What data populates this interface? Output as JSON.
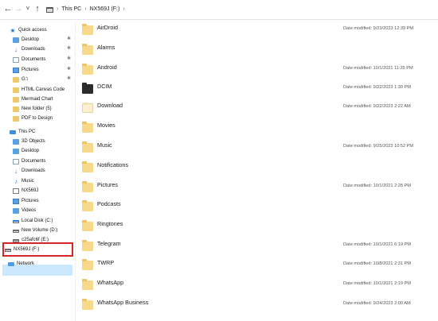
{
  "address_bar": {
    "back_glyph": "←",
    "forward_glyph": "→",
    "recent_glyph": "˅",
    "up_glyph": "↑",
    "breadcrumb": [
      "This PC",
      "NX569J (F:)"
    ],
    "separator": "›"
  },
  "sidebar": {
    "quick_access": "Quick access",
    "pinned": [
      "Desktop",
      "Downloads",
      "Documents",
      "Pictures",
      "G:\\"
    ],
    "folders": [
      "HTML Canvas Code",
      "Mermaid Chart",
      "New folder (5)",
      "PDF to Design"
    ],
    "this_pc": "This PC",
    "pc_items": [
      "3D Objects",
      "Desktop",
      "Documents",
      "Downloads",
      "Music",
      "NX569J",
      "Pictures",
      "Videos",
      "Local Disk (C:)",
      "New Volume (D:)",
      "c25afc6f (E:)",
      "NX569J (F:)"
    ],
    "network": "Network",
    "pin_glyph": "📌"
  },
  "files": {
    "date_prefix": "Date modified:",
    "rows": [
      {
        "name": "AirDroid",
        "date": "9/23/2023 12:39 PM",
        "icon": "folder"
      },
      {
        "name": "Alarms",
        "date": "",
        "icon": "folder"
      },
      {
        "name": "Android",
        "date": "10/1/2021 11:25 PM",
        "icon": "folder"
      },
      {
        "name": "DCIM",
        "date": "9/22/2023 1:30 PM",
        "icon": "folder-dark"
      },
      {
        "name": "Download",
        "date": "9/22/2023 2:22 AM",
        "icon": "folder-light"
      },
      {
        "name": "Movies",
        "date": "",
        "icon": "folder"
      },
      {
        "name": "Music",
        "date": "9/25/2023 10:52 PM",
        "icon": "folder"
      },
      {
        "name": "Notifications",
        "date": "",
        "icon": "folder"
      },
      {
        "name": "Pictures",
        "date": "10/1/2021 2:28 PM",
        "icon": "folder"
      },
      {
        "name": "Podcasts",
        "date": "",
        "icon": "folder"
      },
      {
        "name": "Ringtones",
        "date": "",
        "icon": "folder"
      },
      {
        "name": "Telegram",
        "date": "10/1/2021 6:19 PM",
        "icon": "folder"
      },
      {
        "name": "TWRP",
        "date": "10/8/2021 2:31 PM",
        "icon": "folder"
      },
      {
        "name": "WhatsApp",
        "date": "10/1/2021 2:19 PM",
        "icon": "folder"
      },
      {
        "name": "WhatsApp Business",
        "date": "9/24/2023 2:00 AM",
        "icon": "folder"
      }
    ]
  },
  "colors": {
    "selection": "#cce8ff",
    "highlight_box": "#d9252a",
    "folder": "#f7d98b"
  }
}
